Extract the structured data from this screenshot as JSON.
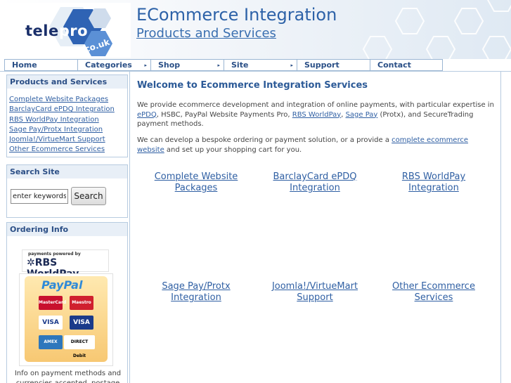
{
  "header": {
    "logo_text_tele": "tele",
    "logo_text_pro": "pro",
    "logo_text_couk": "co.uk",
    "title": "ECommerce Integration",
    "subtitle": "Products and Services"
  },
  "nav": {
    "items": [
      {
        "label": "Home",
        "has_arrow": false
      },
      {
        "label": "Categories",
        "has_arrow": true
      },
      {
        "label": "Shop",
        "has_arrow": true
      },
      {
        "label": "Site",
        "has_arrow": true
      },
      {
        "label": "Support",
        "has_arrow": false
      },
      {
        "label": "Contact",
        "has_arrow": false
      }
    ],
    "arrow": "▸"
  },
  "sidebar": {
    "products": {
      "title": "Products and Services",
      "links": [
        "Complete Website Packages",
        "BarclayCard ePDQ Integration",
        "RBS WorldPay Integration",
        "Sage Pay/Protx Integration",
        "Joomla!/VirtueMart Support",
        "Other Ecommerce Services"
      ]
    },
    "search": {
      "title": "Search Site",
      "input_value": "enter keywords",
      "button_label": "Search"
    },
    "ordering": {
      "title": "Ordering Info",
      "rbs_small": "payments powered by",
      "rbs_main": "✲RBS WorldPay",
      "paypal_pay": "Pay",
      "paypal_pal": "Pal",
      "cards": [
        "MasterCard",
        "Maestro",
        "VISA",
        "VISA",
        "AMEX",
        "DIRECT Debit"
      ],
      "text": "Info on payment methods and currencies accepted, postage"
    }
  },
  "main": {
    "welcome": "Welcome to Ecommerce Integration Services",
    "para1": {
      "t1": "We provide ecommerce development and integration of online payments, with particular expertise in ",
      "l1": "ePDQ",
      "t2": ", HSBC, PayPal Website Payments Pro, ",
      "l2": "RBS WorldPay",
      "t3": ", ",
      "l3": "Sage Pay",
      "t4": " (Protx), and SecureTrading payment methods."
    },
    "para2": {
      "t1": "We can develop a bespoke ordering or payment solution, or a provide a ",
      "l1": "complete ecommerce website",
      "t2": " and set up your shopping cart for you."
    },
    "tiles": [
      "Complete Website Packages",
      "BarclayCard ePDQ Integration",
      "RBS WorldPay Integration",
      "Sage Pay/Protx Integration",
      "Joomla!/VirtueMart Support",
      "Other Ecommerce Services"
    ]
  },
  "colors": {
    "brand_blue": "#2d62a8",
    "link": "#2f5fa3",
    "border": "#b7cbe0",
    "box_header": "#e8eff7"
  }
}
